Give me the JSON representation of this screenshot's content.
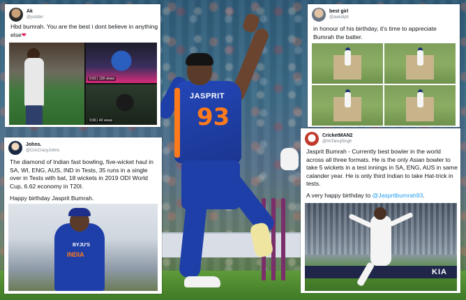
{
  "background": {
    "jersey_name": "JASPRIT",
    "jersey_number": "93",
    "accent_color": "#ff7a1a",
    "jersey_color": "#1f3fa8"
  },
  "tweets": [
    {
      "display_name": "Ak",
      "handle": "@jssbbrr",
      "text": "Hbd bumrah. You are the best i dont believe in anything else",
      "emoji": "❤",
      "media": {
        "video_1": "0:02 | 139 views",
        "video_2": "0:06 | 40 views"
      }
    },
    {
      "display_name": "best girl",
      "handle": "@awkdipti",
      "text": "in honour of his birthday, it's time to appreciate Bumrah the batter."
    },
    {
      "display_name": "Johns.",
      "handle": "@CricCrazyJohns",
      "text": "The diamond of Indian fast bowling, five-wicket haul in SA, WI, ENG, AUS, IND in Tests, 35 runs in a single over in Tests with bat, 18 wickets in 2019 ODI World Cup, 6.62 economy in T20I.",
      "text_2": "Happy birthday Jasprit Bumrah.",
      "media": {
        "sponsor": "BYJU'S",
        "team": "INDIA"
      }
    },
    {
      "display_name": "CricketMAN2",
      "handle": "@ImTanujSingh",
      "text": "Jasprit Bumrah - Currently best bowler in the world across all three formats. He is the only Asian bowler to take 5 wickets in a test innings in SA, ENG, AUS in same calander year. He is only third Indian to take Hat-trick in tests.",
      "text_2_prefix": "A very happy birthday to ",
      "mention": "@Jaspritbumrah93",
      "text_2_suffix": ".",
      "media": {
        "board_text": "KIA"
      }
    }
  ]
}
